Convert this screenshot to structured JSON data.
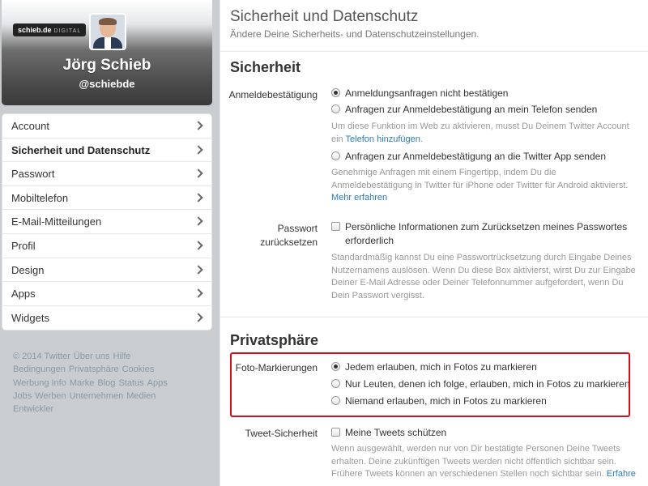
{
  "profile": {
    "banner_logo": "schieb.de",
    "banner_logo_suffix": "DIGITAL",
    "name": "Jörg Schieb",
    "handle": "@schiebde"
  },
  "nav": {
    "items": [
      {
        "label": "Account",
        "active": false
      },
      {
        "label": "Sicherheit und Datenschutz",
        "active": true
      },
      {
        "label": "Passwort",
        "active": false
      },
      {
        "label": "Mobiltelefon",
        "active": false
      },
      {
        "label": "E-Mail-Mitteilungen",
        "active": false
      },
      {
        "label": "Profil",
        "active": false
      },
      {
        "label": "Design",
        "active": false
      },
      {
        "label": "Apps",
        "active": false
      },
      {
        "label": "Widgets",
        "active": false
      }
    ]
  },
  "footer": {
    "links": [
      "© 2014 Twitter",
      "Über uns",
      "Hilfe",
      "Bedingungen",
      "Privatsphäre",
      "Cookies",
      "Werbung Info",
      "Marke",
      "Blog",
      "Status",
      "Apps",
      "Jobs",
      "Werben",
      "Unternehmen",
      "Medien",
      "Entwickler"
    ]
  },
  "main": {
    "title": "Sicherheit und Datenschutz",
    "subtitle": "Ändere Deine Sicherheits- und Datenschutzeinstellungen."
  },
  "security": {
    "title": "Sicherheit",
    "login_label": "Anmeldebestätigung",
    "login_opt1": "Anmeldungsanfragen nicht bestätigen",
    "login_opt2": "Anfragen zur Anmeldebestätigung an mein Telefon senden",
    "login_help2a": "Um diese Funktion im Web zu aktivieren, musst Du Deinem Twitter Account",
    "login_help2b_prefix": "ein",
    "login_help2b_link": "Telefon hinzufügen",
    "login_help2b_suffix": ".",
    "login_opt3": "Anfragen zur Anmeldebestätigung an die Twitter App senden",
    "login_help3a": "Genehmige Anfragen mit einem Fingertipp, indem Du die",
    "login_help3b": "Anmeldebestätigung in Twitter für iPhone oder Twitter für Android aktivierst.",
    "login_help3_link": "Mehr erfahren",
    "pw_label_1": "Passwort",
    "pw_label_2": "zurücksetzen",
    "pw_opt_1": "Persönliche Informationen zum Zurücksetzen meines Passwortes",
    "pw_opt_2": "erforderlich",
    "pw_help_1": "Standardmäßig kannst Du eine Passwortrücksetzung durch Eingabe Deines",
    "pw_help_2": "Nutzernamens auslösen. Wenn Du diese Box aktivierst, wirst Du zur Eingabe",
    "pw_help_3": "Deiner E-Mail Adresse oder Deiner Telefonnummer aufgefordert, wenn Du",
    "pw_help_4": "Dein Passwort vergisst."
  },
  "privacy": {
    "title": "Privatsphäre",
    "photo_label": "Foto-Markierungen",
    "photo_opt1": "Jedem erlauben, mich in Fotos zu markieren",
    "photo_opt2": "Nur Leuten, denen ich folge, erlauben, mich in Fotos zu markieren",
    "photo_opt3": "Niemand erlauben, mich in Fotos zu markieren",
    "tweet_label": "Tweet-Sicherheit",
    "tweet_opt": "Meine Tweets schützen",
    "tweet_help_1": "Wenn ausgewählt, werden nur von Dir bestätigte Personen Deine Tweets",
    "tweet_help_2": "erhalten. Deine zukünftigen Tweets werden nicht öffentlich sichtbar sein.",
    "tweet_help_3": "Frühere Tweets können an verschiedenen Stellen noch sichtbar sein.",
    "tweet_help_link": "Erfahre"
  },
  "colors": {
    "link": "#2b7bb9",
    "highlight": "#d0101e"
  }
}
